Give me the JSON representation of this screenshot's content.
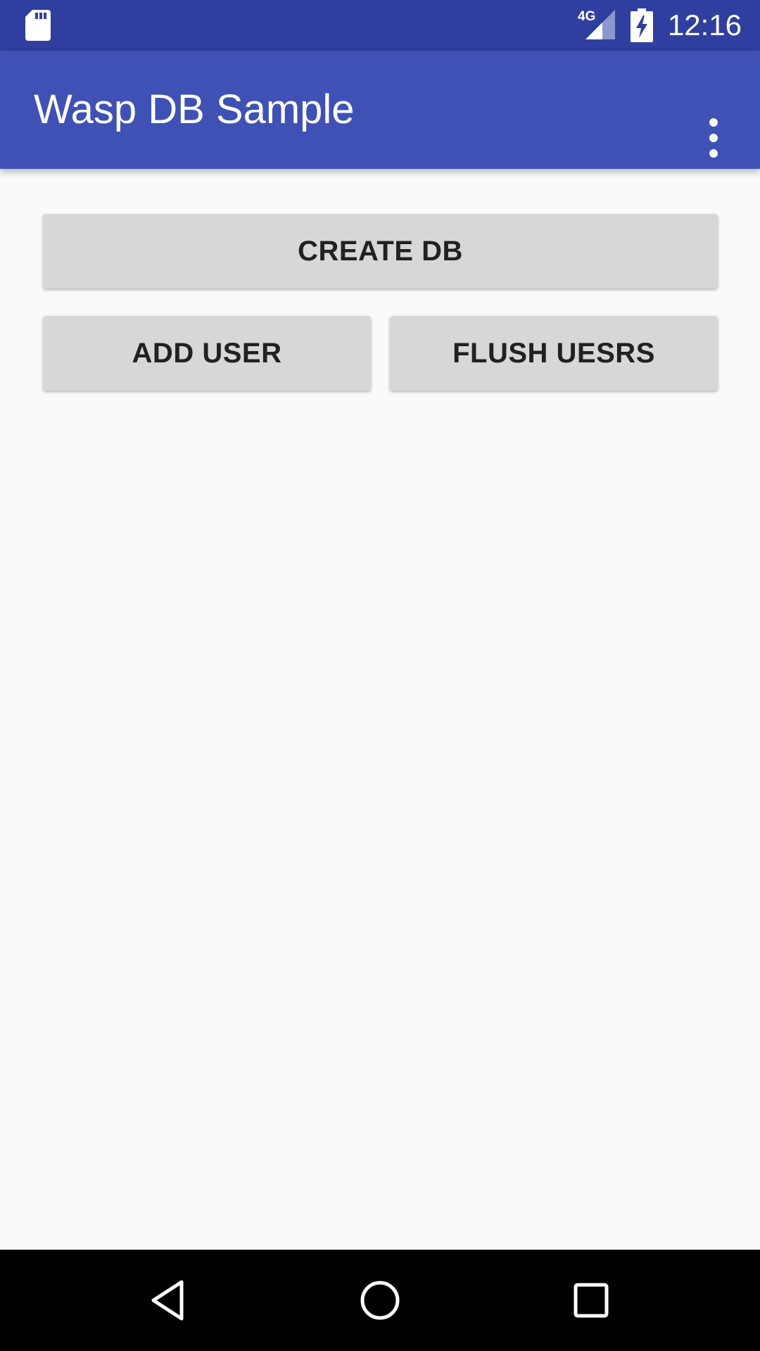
{
  "status_bar": {
    "time": "12:16",
    "network": "4G",
    "icons": [
      "sd-card-icon",
      "signal-icon",
      "battery-charging-icon"
    ],
    "color": "#303f9f"
  },
  "app_bar": {
    "title": "Wasp DB Sample",
    "overflow_icon": "more-vert-icon",
    "color": "#3f51b5"
  },
  "buttons": {
    "create_db": "CREATE DB",
    "add_user": "ADD USER",
    "flush_users": "FLUSH UESRS"
  },
  "nav_bar": {
    "icons": [
      "back-icon",
      "home-icon",
      "recents-icon"
    ]
  }
}
